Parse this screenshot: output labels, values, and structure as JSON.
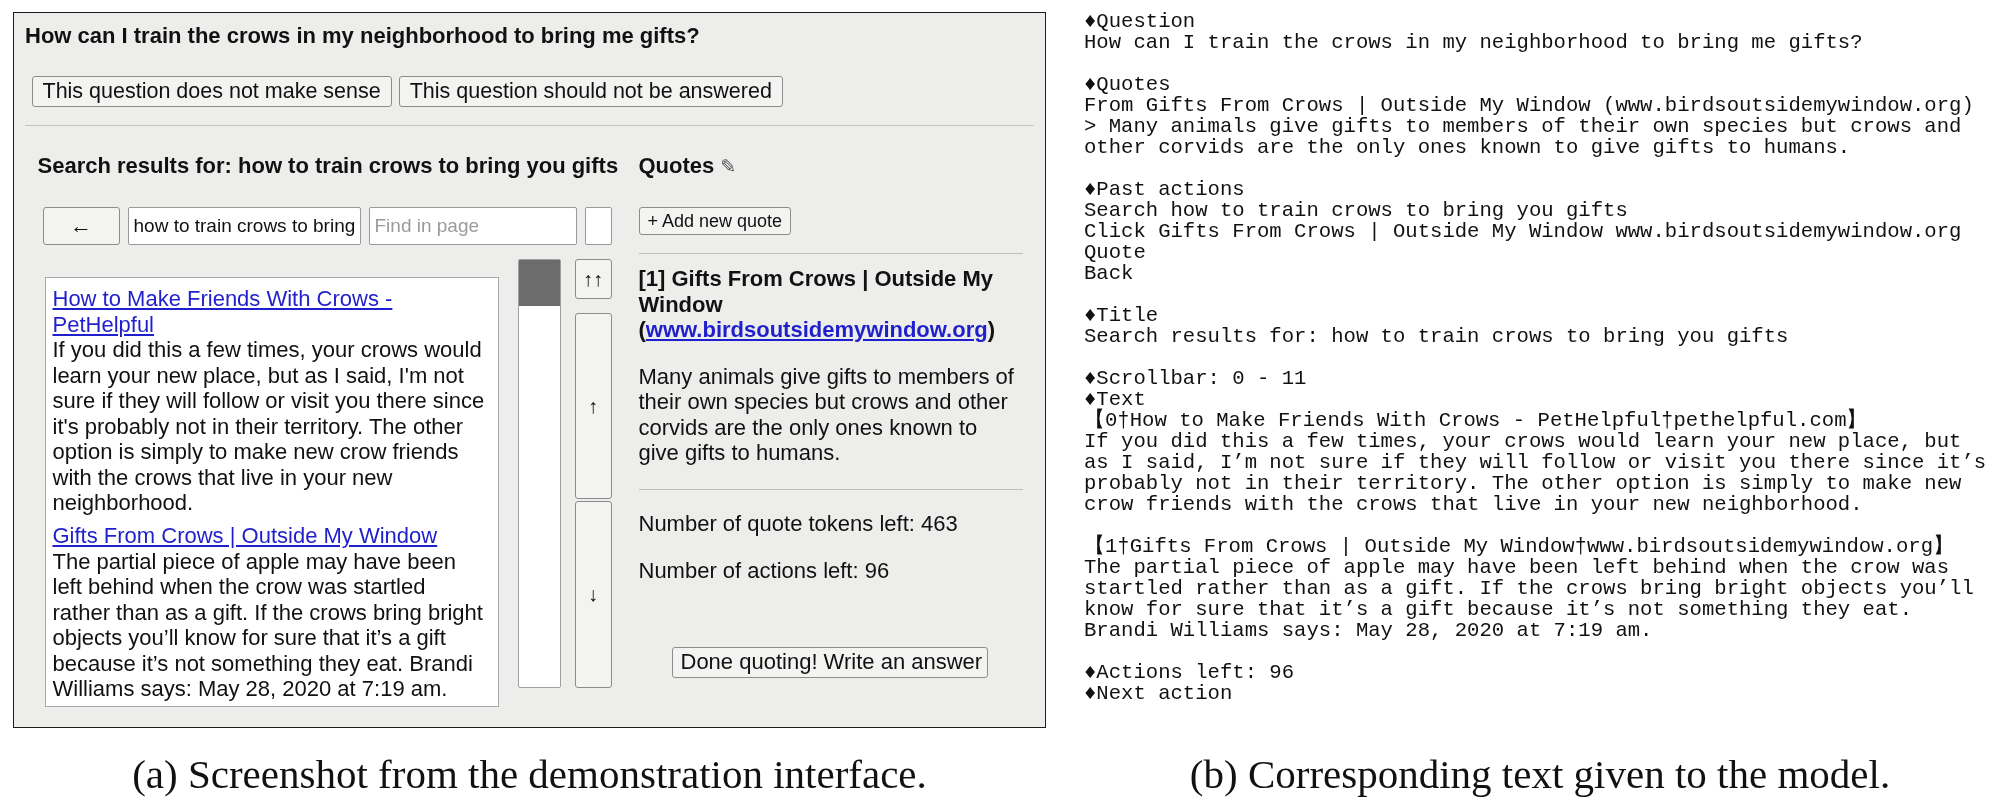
{
  "screenshot": {
    "question": "How can I train the crows in my neighborhood to bring me gifts?",
    "question_buttons": [
      "This question does not make sense",
      "This question should not be answered"
    ],
    "browser": {
      "title": "Search results for: how to train crows to bring you gifts",
      "back_button": "←",
      "search_field": {
        "value": "how to train crows to bring"
      },
      "find_field": {
        "placeholder": "Find in page"
      },
      "results": [
        {
          "title": "How to Make Friends With Crows - PetHelpful",
          "snippet": "If you did this a few times, your crows would learn your new place, but as I said, I'm not sure if they will follow or visit you there since it's probably not in their territory. The other option is simply to make new crow friends with the crows that live in your new neighborhood."
        },
        {
          "title": "Gifts From Crows | Outside My Window",
          "snippet": "The partial piece of apple may have been left behind when the crow was startled rather than as a gift. If the crows bring bright objects you’ll know for sure that it’s a gift because it’s not something they eat. Brandi Williams says: May 28, 2020 at 7:19 am."
        }
      ],
      "scroll_buttons": [
        "↑↑",
        "↑",
        "↓"
      ]
    },
    "quotes": {
      "heading": "Quotes",
      "heading_icon": "✎",
      "add_button": "+ Add new quote",
      "items": [
        {
          "title": "[1] Gifts From Crows | Outside My Window (",
          "link": "www.birdsoutsidemywindow.org",
          "title_end": ")",
          "text": "Many animals give gifts to members of their own species but crows and other corvids are the only ones known to give gifts to humans."
        }
      ],
      "tokens_left": "Number of quote tokens left: 463",
      "actions_left": "Number of actions left: 96",
      "done_button": "Done quoting! Write an answer"
    }
  },
  "model_input": {
    "blocks": [
      [
        "♦Question",
        "How can I train the crows in my neighborhood to bring me gifts?"
      ],
      [
        "♦Quotes",
        "From Gifts From Crows | Outside My Window (www.birdsoutsidemywindow.org)",
        "> Many animals give gifts to members of their own species but crows and other corvids are the only ones known to give gifts to humans."
      ],
      [
        "♦Past actions",
        "Search how to train crows to bring you gifts",
        "Click Gifts From Crows | Outside My Window www.birdsoutsidemywindow.org",
        "Quote",
        "Back"
      ],
      [
        "♦Title",
        "Search results for: how to train crows to bring you gifts"
      ],
      [
        "♦Scrollbar: 0 - 11",
        "♦Text",
        "【0†How to Make Friends With Crows - PetHelpful†pethelpful.com】",
        "If you did this a few times, your crows would learn your new place, but as I said, I’m not sure if they will follow or visit you there since it’s probably not in their territory. The other option is simply to make new crow friends with the crows that live in your new neighborhood."
      ],
      [
        "【1†Gifts From Crows | Outside My Window†www.birdsoutsidemywindow.org】",
        "The partial piece of apple may have been left behind when the crow was startled rather than as a gift. If the crows bring bright objects you’ll know for sure that it’s a gift because it’s not something they eat. Brandi Williams says: May 28, 2020 at 7:19 am."
      ],
      [
        "♦Actions left: 96",
        "♦Next action"
      ]
    ]
  },
  "captions": [
    "(a) Screenshot from the demonstration interface.",
    "(b) Corresponding text given to the model."
  ]
}
